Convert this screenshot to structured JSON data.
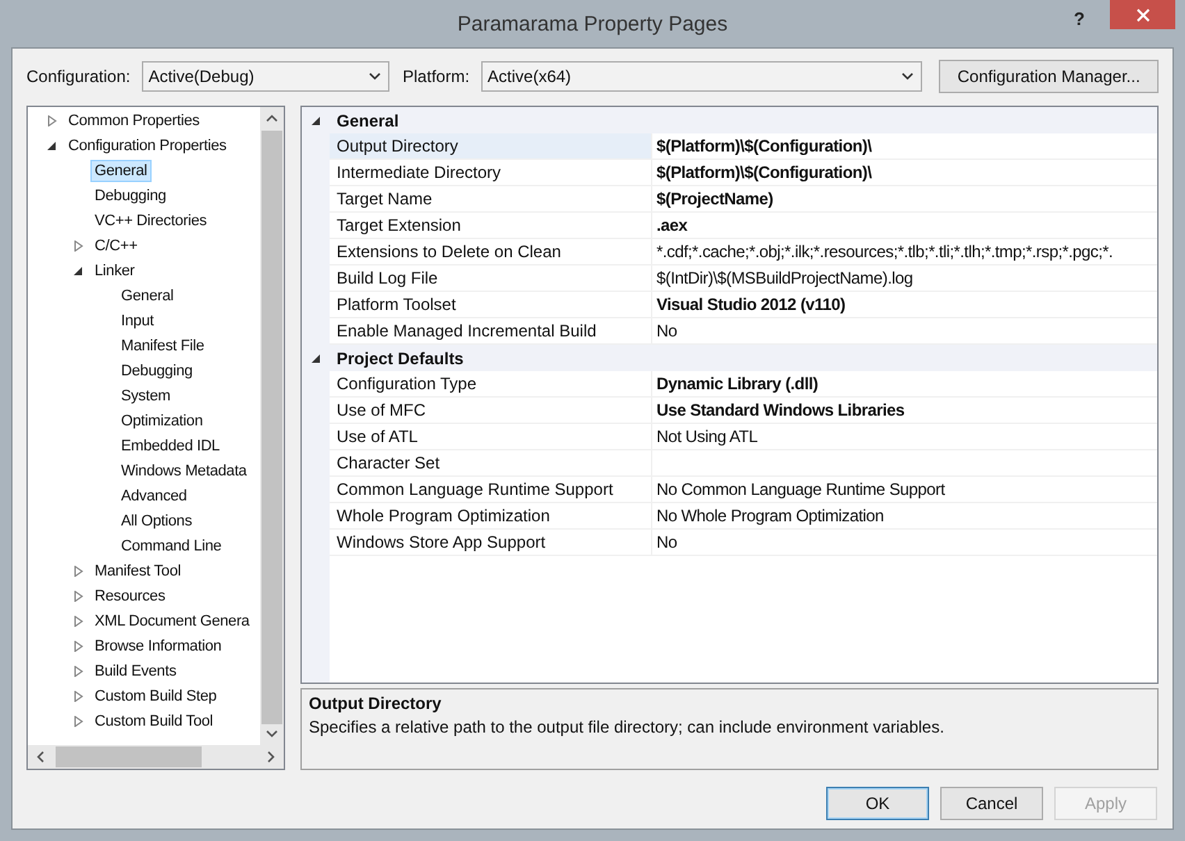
{
  "window": {
    "title": "Paramarama Property Pages",
    "help": "?"
  },
  "toolbar": {
    "configuration_label": "Configuration:",
    "configuration": "Active(Debug)",
    "platform_label": "Platform:",
    "platform": "Active(x64)",
    "manager_button": "Configuration Manager..."
  },
  "tree": [
    {
      "label": "Common Properties",
      "expanded": false,
      "selected": false
    },
    {
      "label": "Configuration Properties",
      "expanded": true,
      "selected": false,
      "children": [
        {
          "label": "General",
          "selected": true
        },
        {
          "label": "Debugging",
          "selected": false
        },
        {
          "label": "VC++ Directories",
          "selected": false
        },
        {
          "label": "C/C++",
          "expanded": false,
          "selected": false
        },
        {
          "label": "Linker",
          "expanded": true,
          "selected": false,
          "children": [
            {
              "label": "General",
              "selected": false
            },
            {
              "label": "Input",
              "selected": false
            },
            {
              "label": "Manifest File",
              "selected": false
            },
            {
              "label": "Debugging",
              "selected": false
            },
            {
              "label": "System",
              "selected": false
            },
            {
              "label": "Optimization",
              "selected": false
            },
            {
              "label": "Embedded IDL",
              "selected": false
            },
            {
              "label": "Windows Metadata",
              "selected": false
            },
            {
              "label": "Advanced",
              "selected": false
            },
            {
              "label": "All Options",
              "selected": false
            },
            {
              "label": "Command Line",
              "selected": false
            }
          ]
        },
        {
          "label": "Manifest Tool",
          "expanded": false,
          "selected": false
        },
        {
          "label": "Resources",
          "expanded": false,
          "selected": false
        },
        {
          "label": "XML Document Genera",
          "expanded": false,
          "selected": false
        },
        {
          "label": "Browse Information",
          "expanded": false,
          "selected": false
        },
        {
          "label": "Build Events",
          "expanded": false,
          "selected": false
        },
        {
          "label": "Custom Build Step",
          "expanded": false,
          "selected": false
        },
        {
          "label": "Custom Build Tool",
          "expanded": false,
          "selected": false
        }
      ]
    }
  ],
  "grid": [
    {
      "title": "General",
      "expanded": true,
      "rows": [
        {
          "name": "Output Directory",
          "value": "$(Platform)\\$(Configuration)\\",
          "bold": true,
          "selected": true
        },
        {
          "name": "Intermediate Directory",
          "value": "$(Platform)\\$(Configuration)\\",
          "bold": true,
          "selected": false
        },
        {
          "name": "Target Name",
          "value": "$(ProjectName)",
          "bold": true,
          "selected": false
        },
        {
          "name": "Target Extension",
          "value": ".aex",
          "bold": true,
          "selected": false
        },
        {
          "name": "Extensions to Delete on Clean",
          "value": "*.cdf;*.cache;*.obj;*.ilk;*.resources;*.tlb;*.tli;*.tlh;*.tmp;*.rsp;*.pgc;*.",
          "bold": false,
          "selected": false
        },
        {
          "name": "Build Log File",
          "value": "$(IntDir)\\$(MSBuildProjectName).log",
          "bold": false,
          "selected": false
        },
        {
          "name": "Platform Toolset",
          "value": "Visual Studio 2012 (v110)",
          "bold": true,
          "selected": false
        },
        {
          "name": "Enable Managed Incremental Build",
          "value": "No",
          "bold": false,
          "selected": false
        }
      ]
    },
    {
      "title": "Project Defaults",
      "expanded": true,
      "rows": [
        {
          "name": "Configuration Type",
          "value": "Dynamic Library (.dll)",
          "bold": true,
          "selected": false
        },
        {
          "name": "Use of MFC",
          "value": "Use Standard Windows Libraries",
          "bold": true,
          "selected": false
        },
        {
          "name": "Use of ATL",
          "value": "Not Using ATL",
          "bold": false,
          "selected": false
        },
        {
          "name": "Character Set",
          "bold": false,
          "selected": false
        },
        {
          "name": "Common Language Runtime Support",
          "value": "No Common Language Runtime Support",
          "bold": false,
          "selected": false
        },
        {
          "name": "Whole Program Optimization",
          "value": "No Whole Program Optimization",
          "bold": false,
          "selected": false
        },
        {
          "name": "Windows Store App Support",
          "value": "No",
          "bold": false,
          "selected": false
        }
      ]
    }
  ],
  "description": {
    "title": "Output Directory",
    "text": "Specifies a relative path to the output file directory; can include environment variables."
  },
  "buttons": [
    {
      "label": "OK",
      "kind": "default",
      "disabled": false
    },
    {
      "label": "Cancel",
      "kind": "normal",
      "disabled": false
    },
    {
      "label": "Apply",
      "kind": "normal",
      "disabled": true
    }
  ]
}
